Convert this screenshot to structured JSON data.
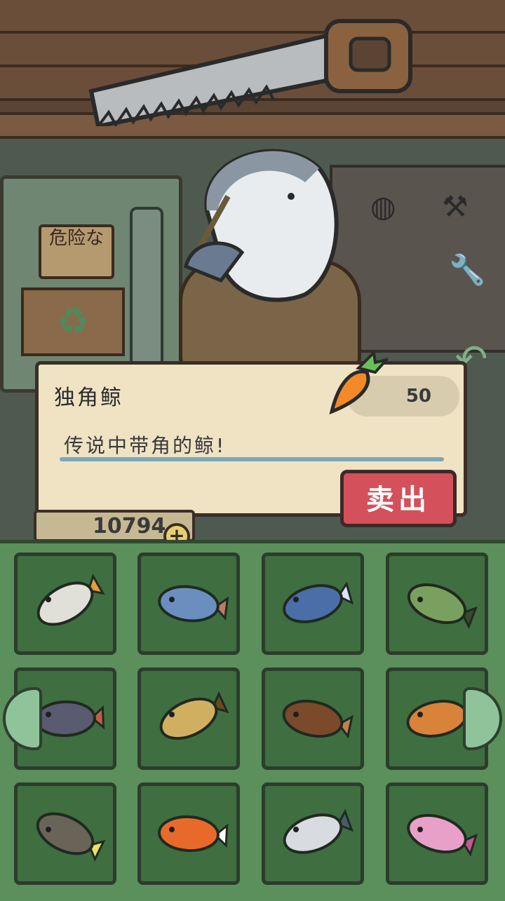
{
  "selected_item": {
    "name": "独角鲸",
    "description": "传说中带角的鲸!",
    "price": "50",
    "sell_label": "卖出"
  },
  "wall_sign": "危险な",
  "currency": {
    "amount": "10794",
    "plus_label": "+"
  },
  "icons": {
    "back": "back-arrow-icon",
    "carrot": "carrot-icon",
    "nav_left": "chevron-left-icon",
    "nav_right": "chevron-right-icon"
  },
  "colors": {
    "sell_button": "#d4505a",
    "panel_bg": "#5b8f5b",
    "slot_bg": "#3f6e41",
    "dialog_bg": "#f0e3c4"
  },
  "inventory": [
    {
      "id": "angelfish",
      "color": "#e0e0d8",
      "accent": "#e89a3a"
    },
    {
      "id": "blue-fish",
      "color": "#6a8fbf",
      "accent": "#c07a6a"
    },
    {
      "id": "slim-fish",
      "color": "#4a6fa8",
      "accent": "#e0e0ff"
    },
    {
      "id": "perch",
      "color": "#7aa060",
      "accent": "#3a4a30"
    },
    {
      "id": "flounder",
      "color": "#5a5a70",
      "accent": "#c06040"
    },
    {
      "id": "goby",
      "color": "#d0b060",
      "accent": "#6a4a20"
    },
    {
      "id": "sea-cucumber",
      "color": "#7a4a2a",
      "accent": "#c08050"
    },
    {
      "id": "octopus",
      "color": "#d9823a",
      "accent": "#8a4a1a"
    },
    {
      "id": "anglerfish",
      "color": "#6a6458",
      "accent": "#f0e060"
    },
    {
      "id": "clownfish",
      "color": "#e86a2a",
      "accent": "#ffffff"
    },
    {
      "id": "narwhal",
      "color": "#d8dce0",
      "accent": "#4a5a6a"
    },
    {
      "id": "axolotl",
      "color": "#e8a0c8",
      "accent": "#c05a90"
    }
  ]
}
